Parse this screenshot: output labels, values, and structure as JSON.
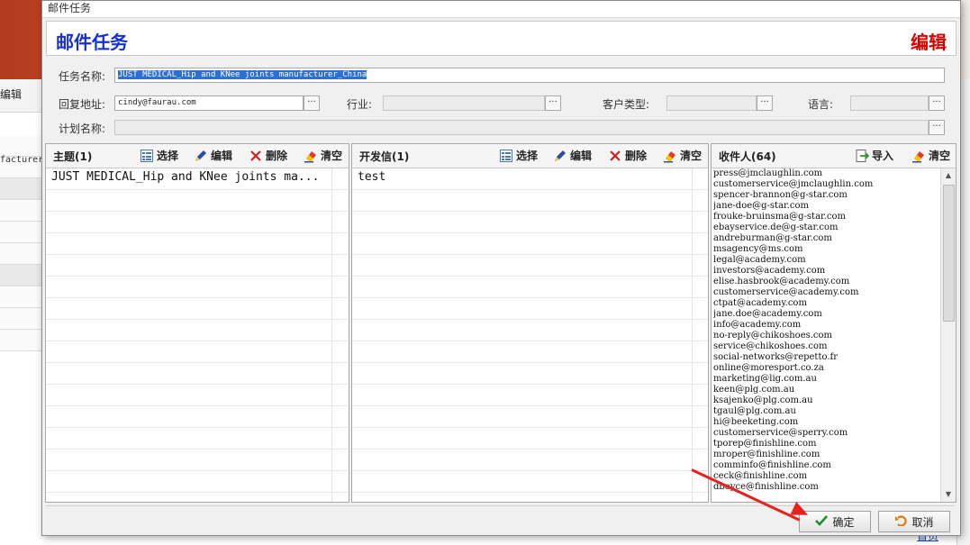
{
  "window_title": "邮件任务",
  "header": {
    "left_title": "邮件任务",
    "right_title": "编辑"
  },
  "form": {
    "task_name_label": "任务名称:",
    "task_name_value": "JUST MEDICAL_Hip and KNee joints manufacturer_China",
    "reply_label": "回复地址:",
    "reply_value": "cindy@faurau.com",
    "industry_label": "行业:",
    "industry_value": "",
    "customer_type_label": "客户类型:",
    "customer_type_value": "",
    "language_label": "语言:",
    "language_value": "",
    "plan_label": "计划名称:",
    "plan_value": "",
    "ellipsis": "···"
  },
  "subject_panel": {
    "title": "主题(1)",
    "tools": {
      "select": "选择",
      "edit": "编辑",
      "delete": "删除",
      "clear": "清空"
    },
    "rows": [
      "JUST MEDICAL_Hip and KNee joints ma..."
    ]
  },
  "letter_panel": {
    "title": "开发信(1)",
    "tools": {
      "select": "选择",
      "edit": "编辑",
      "delete": "删除",
      "clear": "清空"
    },
    "rows": [
      "test"
    ]
  },
  "recipient_panel": {
    "title": "收件人(64)",
    "tools": {
      "import": "导入",
      "clear": "清空"
    },
    "items": [
      "press@jmclaughlin.com",
      "customerservice@jmclaughlin.com",
      "spencer-brannon@g-star.com",
      "jane-doe@g-star.com",
      "frouke-bruinsma@g-star.com",
      "ebayservice.de@g-star.com",
      "andreburman@g-star.com",
      "msagency@ms.com",
      "legal@academy.com",
      "investors@academy.com",
      "elise.hasbrook@academy.com",
      "customerservice@academy.com",
      "ctpat@academy.com",
      "jane.doe@academy.com",
      "info@academy.com",
      "no-reply@chikoshoes.com",
      "service@chikoshoes.com",
      "social-networks@repetto.fr",
      "online@moresport.co.za",
      "marketing@lig.com.au",
      "keen@plg.com.au",
      "ksajenko@plg.com.au",
      "tgaul@plg.com.au",
      "hi@beeketing.com",
      "customerservice@sperry.com",
      "tporep@finishline.com",
      "mroper@finishline.com",
      "comminfo@finishline.com",
      "ceck@finishline.com",
      "dboyce@finishline.com"
    ]
  },
  "footer": {
    "confirm": "确定",
    "cancel": "取消"
  },
  "background": {
    "toolbar_edit": "编辑",
    "cell_text": "facturer_(",
    "link_text": "首页"
  },
  "colors": {
    "header_left": "#1530d9",
    "header_right": "#d90000",
    "selection": "#2e6fd3",
    "annotation_arrow": "#e8211f"
  }
}
